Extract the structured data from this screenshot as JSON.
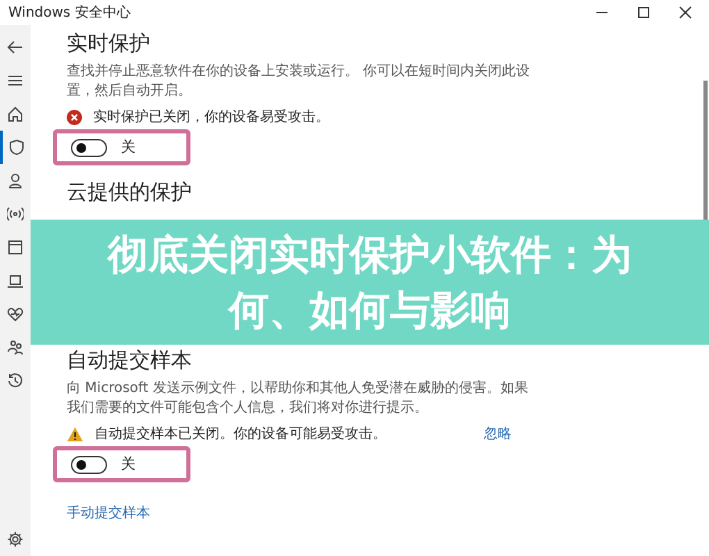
{
  "window": {
    "title": "Windows 安全中心"
  },
  "sidebar": {
    "items": [
      {
        "selected": false
      },
      {
        "selected": false
      },
      {
        "selected": false
      },
      {
        "selected": true
      },
      {
        "selected": false
      },
      {
        "selected": false
      },
      {
        "selected": false
      },
      {
        "selected": false
      },
      {
        "selected": false
      },
      {
        "selected": false
      },
      {
        "selected": false
      }
    ],
    "settings": {
      "selected": false
    }
  },
  "sections": [
    {
      "title": "实时保护",
      "description": "查找并停止恶意软件在你的设备上安装或运行。 你可以在短时间内关闭此设置，然后自动开启。",
      "status": {
        "kind": "error",
        "text": "实时保护已关闭，你的设备易受攻击。"
      },
      "toggle": {
        "on": false,
        "label": "关",
        "highlighted": true
      }
    },
    {
      "title": "云提供的保护"
    },
    {
      "title": "自动提交样本",
      "description": "向 Microsoft 发送示例文件，以帮助你和其他人免受潜在威胁的侵害。如果我们需要的文件可能包含个人信息，我们将对你进行提示。",
      "status": {
        "kind": "warning",
        "text": "自动提交样本已关闭。你的设备可能易受攻击。",
        "dismiss": "忽略"
      },
      "toggle": {
        "on": false,
        "label": "关",
        "highlighted": true
      }
    }
  ],
  "link": "手动提交样本",
  "banner": {
    "title": "彻底关闭实时保护小软件：为何、如何与影响"
  }
}
